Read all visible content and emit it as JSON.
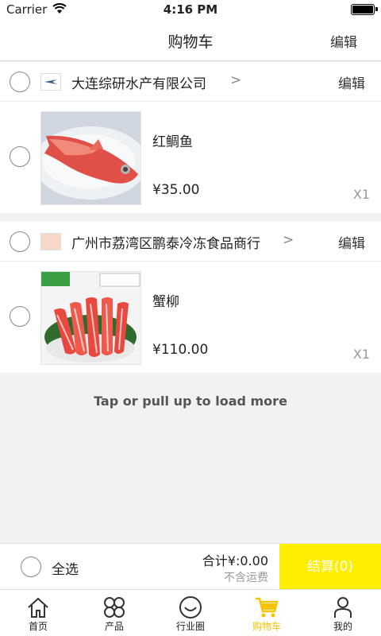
{
  "status_bar": {
    "carrier": "Carrier",
    "time": "4:16 PM"
  },
  "nav": {
    "title": "购物车",
    "edit_label": "编辑"
  },
  "shops": [
    {
      "name": "大连综研水产有限公司",
      "edit_label": "编辑",
      "items": [
        {
          "name": "红鲷鱼",
          "price": "¥35.00",
          "qty": "X1"
        }
      ]
    },
    {
      "name": "广州市荔湾区鹏泰冷冻食品商行",
      "edit_label": "编辑",
      "items": [
        {
          "name": "蟹柳",
          "price": "¥110.00",
          "qty": "X1"
        }
      ]
    }
  ],
  "load_more": "Tap or pull up to load more",
  "checkout": {
    "select_all_label": "全选",
    "total": "合计¥:0.00",
    "shipping_note": "不含运费",
    "pay_button": "结算(0)"
  },
  "tabs": [
    {
      "label": "首页",
      "icon": "home-icon"
    },
    {
      "label": "产品",
      "icon": "grid-icon"
    },
    {
      "label": "行业圈",
      "icon": "smile-icon"
    },
    {
      "label": "购物车",
      "icon": "cart-icon",
      "active": true
    },
    {
      "label": "我的",
      "icon": "user-icon"
    }
  ],
  "colors": {
    "accent": "#ffee00",
    "active_tab": "#f5c400"
  }
}
